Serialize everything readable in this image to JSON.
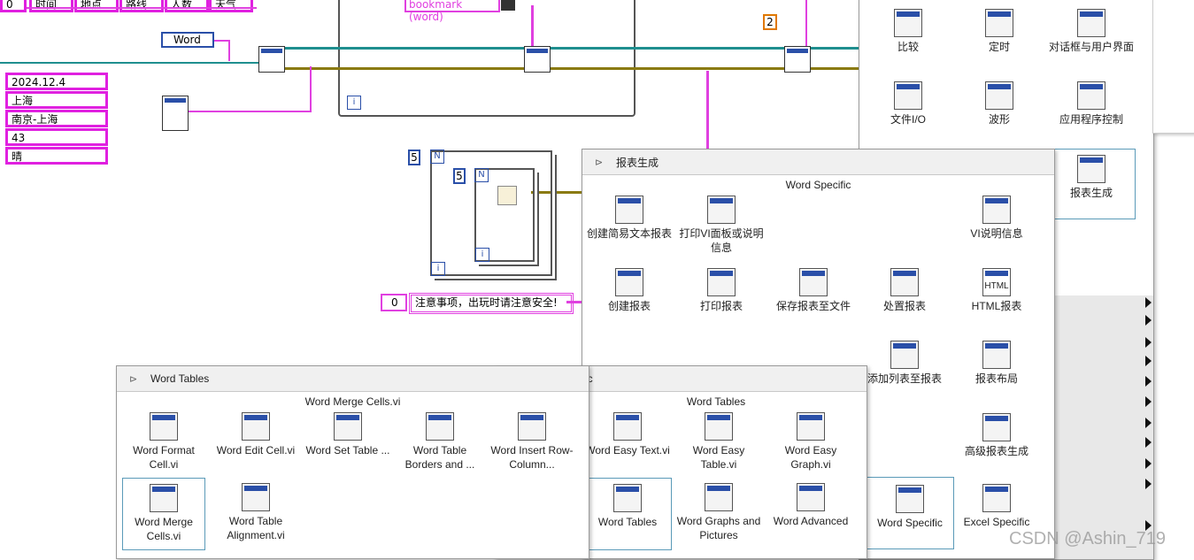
{
  "top_headers": [
    "0",
    "时间",
    "地点",
    "路线",
    "人数",
    "天气"
  ],
  "bookmark_label": "bookmark (word)",
  "word_ring": "Word",
  "constant_two": "2",
  "data_column": [
    "2024.12.4",
    "上海",
    "南京-上海",
    "43",
    "晴"
  ],
  "loop_count_outer": "5",
  "loop_count_inner": "5",
  "loop_n": "N",
  "loop_i": "i",
  "notice_index": "0",
  "notice_text": "注意事项，出玩时请注意安全!",
  "top_palette": {
    "items": [
      {
        "label": "比较",
        "icon": "compare-icon"
      },
      {
        "label": "定时",
        "icon": "timing-icon"
      },
      {
        "label": "对话框与用户界面",
        "icon": "dialog-icon"
      },
      {
        "label": "文件I/O",
        "icon": "file-io-icon"
      },
      {
        "label": "波形",
        "icon": "waveform-icon"
      },
      {
        "label": "应用程序控制",
        "icon": "app-control-icon"
      },
      {
        "label": "报表生成",
        "icon": "report-icon"
      }
    ]
  },
  "report_palette": {
    "title": "报表生成",
    "subtitle": "Word Specific",
    "items": [
      {
        "label": "创建简易文本报表",
        "icon": "easy-text-report-icon"
      },
      {
        "label": "打印VI面板或说明信息",
        "icon": "print-vi-panel-icon"
      },
      {
        "label": "VI说明信息",
        "icon": "vi-doc-icon"
      },
      {
        "label": "创建报表",
        "icon": "new-report-icon"
      },
      {
        "label": "打印报表",
        "icon": "print-report-icon"
      },
      {
        "label": "保存报表至文件",
        "icon": "save-report-icon"
      },
      {
        "label": "处置报表",
        "icon": "dispose-report-icon"
      },
      {
        "label": "HTML报表",
        "icon": "html-report-icon"
      },
      {
        "label": "添加列表至报表",
        "icon": "append-list-icon"
      },
      {
        "label": "报表布局",
        "icon": "report-layout-icon"
      },
      {
        "label": "高级报表生成",
        "icon": "advanced-report-icon"
      },
      {
        "label": "Word Specific",
        "icon": "word-specific-icon"
      },
      {
        "label": "Excel Specific",
        "icon": "excel-specific-icon"
      }
    ],
    "html_icon_text": "HTML"
  },
  "word_tables_mid": {
    "title_fragment": "ic",
    "subtitle": "Word Tables",
    "items": [
      {
        "label": "Word Easy Text.vi",
        "icon": "easy-text-icon"
      },
      {
        "label": "Word Easy Table.vi",
        "icon": "easy-table-icon"
      },
      {
        "label": "Word Easy Graph.vi",
        "icon": "easy-graph-icon"
      },
      {
        "label": "Word Tables",
        "icon": "word-tables-icon"
      },
      {
        "label": "Word Graphs and Pictures",
        "icon": "graphs-pictures-icon"
      },
      {
        "label": "Word Advanced",
        "icon": "word-advanced-icon"
      }
    ]
  },
  "word_tables_palette": {
    "title": "Word Tables",
    "subtitle": "Word Merge Cells.vi",
    "items": [
      {
        "label": "Word Format Cell.vi",
        "icon": "format-cell-icon"
      },
      {
        "label": "Word Edit Cell.vi",
        "icon": "edit-cell-icon"
      },
      {
        "label": "Word Set Table ...",
        "icon": "set-table-icon"
      },
      {
        "label": "Word Table Borders and ...",
        "icon": "table-borders-icon"
      },
      {
        "label": "Word Insert Row-Column...",
        "icon": "insert-row-column-icon"
      },
      {
        "label": "Word Merge Cells.vi",
        "icon": "merge-cells-icon"
      },
      {
        "label": "Word Table Alignment.vi",
        "icon": "table-alignment-icon"
      }
    ]
  },
  "watermark": "CSDN @Ashin_719"
}
